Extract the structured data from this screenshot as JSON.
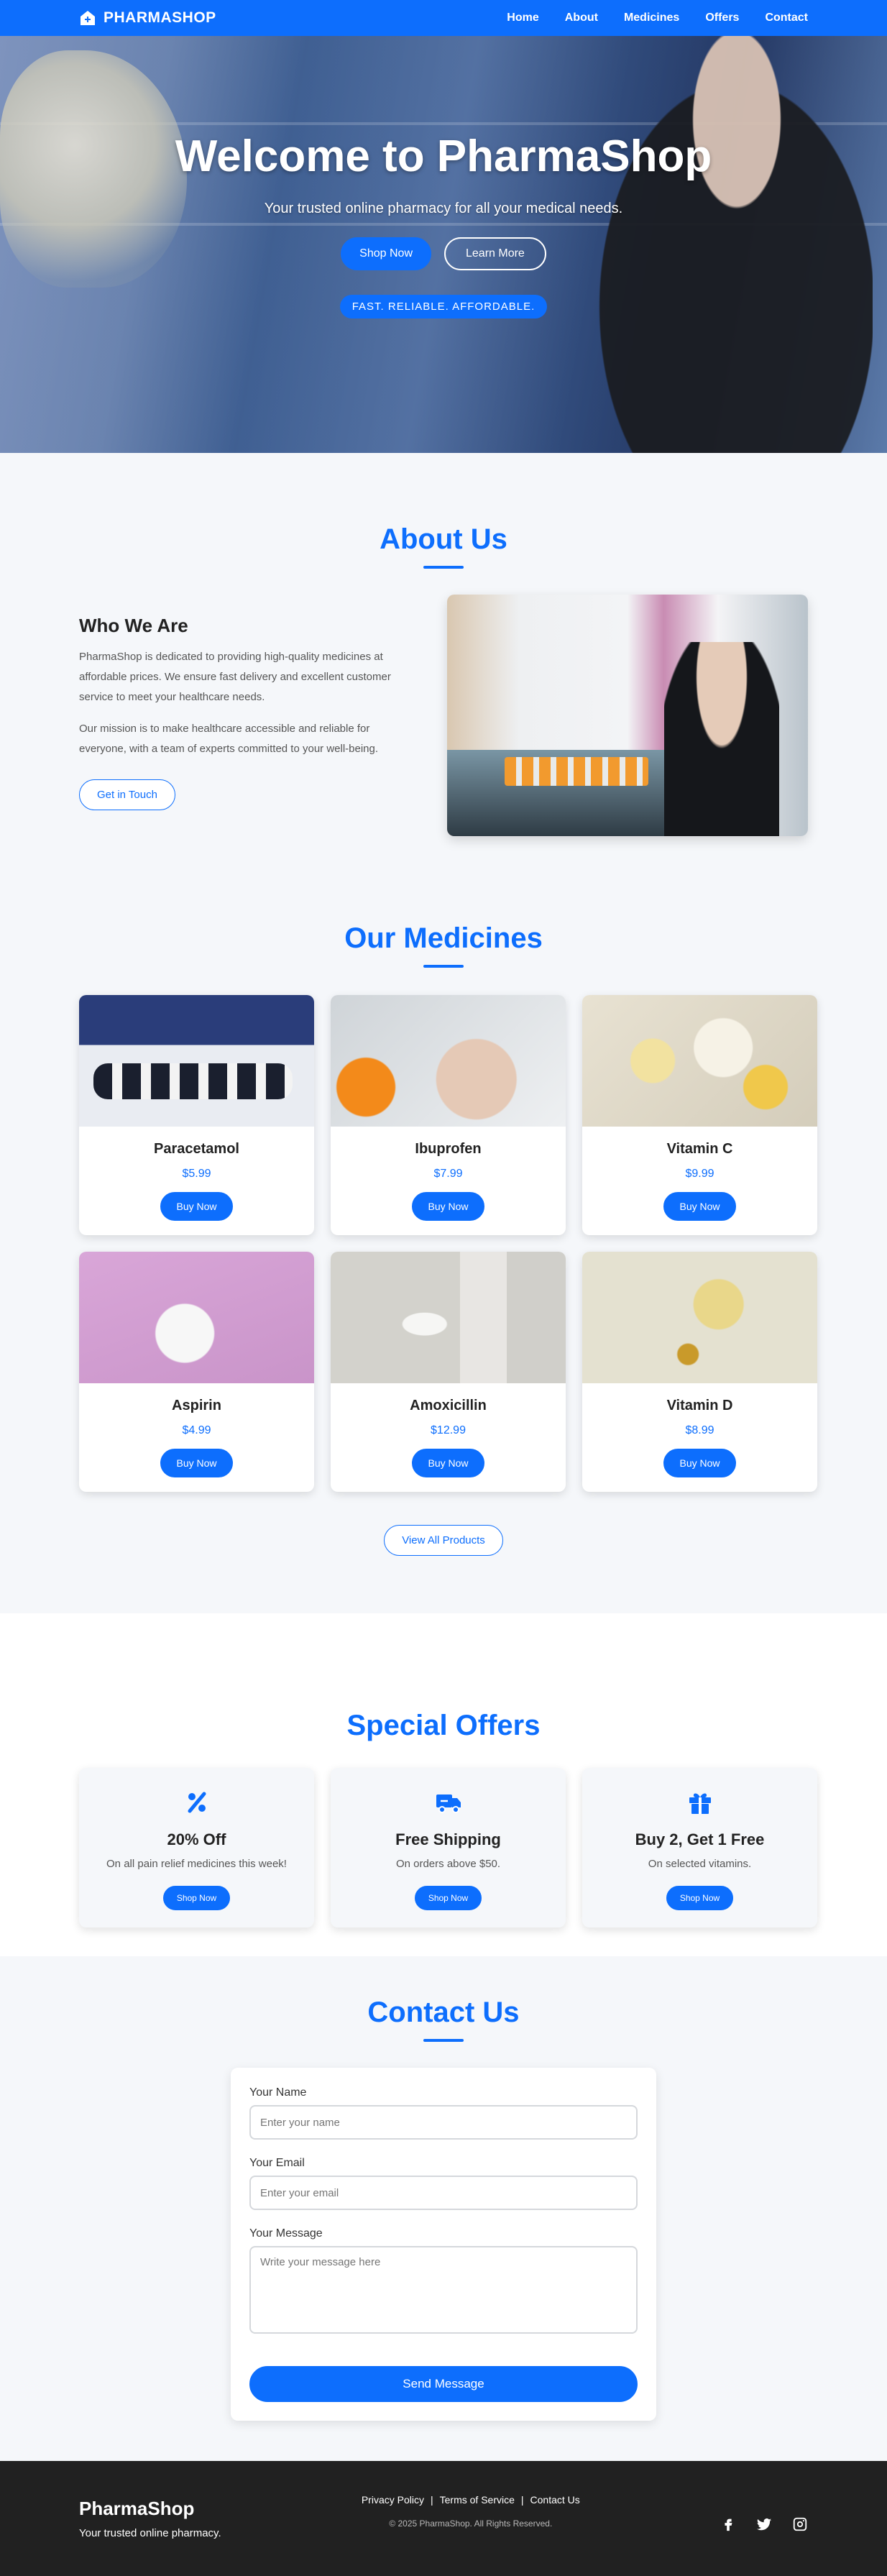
{
  "nav": {
    "brand": "PHARMASHOP",
    "links": [
      "Home",
      "About",
      "Medicines",
      "Offers",
      "Contact"
    ]
  },
  "hero": {
    "title": "Welcome to PharmaShop",
    "subtitle": "Your trusted online pharmacy for all your medical needs.",
    "primary_button": "Shop Now",
    "secondary_button": "Learn More",
    "tagline": "FAST. RELIABLE. AFFORDABLE."
  },
  "about": {
    "title": "About Us",
    "heading": "Who We Are",
    "paragraph1": "PharmaShop is dedicated to providing high-quality medicines at affordable prices. We ensure fast delivery and excellent customer service to meet your healthcare needs.",
    "paragraph2": "Our mission is to make healthcare accessible and reliable for everyone, with a team of experts committed to your well-being.",
    "button": "Get in Touch"
  },
  "medicines": {
    "title": "Our Medicines",
    "items": [
      {
        "name": "Paracetamol",
        "price": "$5.99",
        "button": "Buy Now"
      },
      {
        "name": "Ibuprofen",
        "price": "$7.99",
        "button": "Buy Now"
      },
      {
        "name": "Vitamin C",
        "price": "$9.99",
        "button": "Buy Now"
      },
      {
        "name": "Aspirin",
        "price": "$4.99",
        "button": "Buy Now"
      },
      {
        "name": "Amoxicillin",
        "price": "$12.99",
        "button": "Buy Now"
      },
      {
        "name": "Vitamin D",
        "price": "$8.99",
        "button": "Buy Now"
      }
    ],
    "view_all": "View All Products"
  },
  "offers": {
    "title": "Special Offers",
    "items": [
      {
        "icon": "percent-icon",
        "title": "20% Off",
        "text": "On all pain relief medicines this week!",
        "button": "Shop Now"
      },
      {
        "icon": "truck-icon",
        "title": "Free Shipping",
        "text": "On orders above $50.",
        "button": "Shop Now"
      },
      {
        "icon": "gift-icon",
        "title": "Buy 2, Get 1 Free",
        "text": "On selected vitamins.",
        "button": "Shop Now"
      }
    ]
  },
  "contact": {
    "title": "Contact Us",
    "name_label": "Your Name",
    "name_placeholder": "Enter your name",
    "email_label": "Your Email",
    "email_placeholder": "Enter your email",
    "message_label": "Your Message",
    "message_placeholder": "Write your message here",
    "submit": "Send Message"
  },
  "footer": {
    "brand": "PharmaShop",
    "tagline": "Your trusted online pharmacy.",
    "links": [
      "Privacy Policy",
      "Terms of Service",
      "Contact Us"
    ],
    "copyright": "© 2025 PharmaShop. All Rights Reserved.",
    "social": [
      "facebook-icon",
      "twitter-icon",
      "instagram-icon"
    ]
  },
  "colors": {
    "primary": "#0d6efd",
    "section_bg": "#f5f7fa",
    "footer_bg": "#212121"
  }
}
